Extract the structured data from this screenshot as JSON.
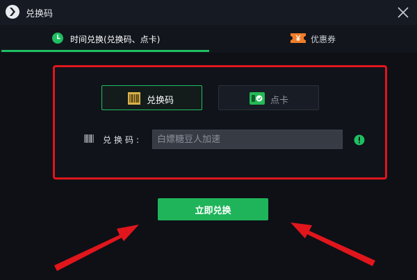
{
  "window": {
    "title": "兑换码",
    "close_label": "×"
  },
  "tabs": [
    {
      "label": "时间兑换(兑换码、点卡)",
      "icon": "clock-icon",
      "active": true
    },
    {
      "label": "优惠券",
      "icon": "ticket-icon",
      "active": false
    }
  ],
  "modes": [
    {
      "label": "兑换码",
      "icon": "barcode-icon",
      "selected": true
    },
    {
      "label": "点卡",
      "icon": "card-icon",
      "selected": false
    }
  ],
  "field": {
    "label": "兑换码:",
    "placeholder": "白嫖糖豆人加速",
    "value": ""
  },
  "submit": {
    "label": "立即兑换"
  },
  "colors": {
    "accent": "#1fbf62",
    "highlight": "#e0161c",
    "coupon": "#f07d2a"
  }
}
